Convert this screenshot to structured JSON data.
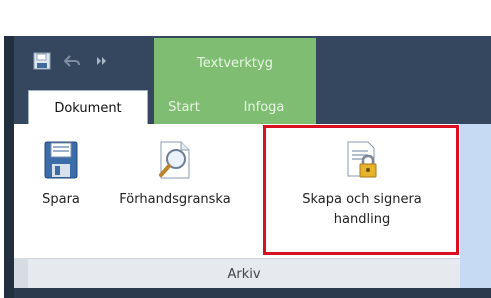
{
  "quick_access": {
    "save_icon": "floppy-save-icon",
    "undo_icon": "undo-arrow-icon",
    "more_icon": "double-chevron-icon"
  },
  "context_group": {
    "title": "Textverktyg"
  },
  "tabs": [
    {
      "label": "Dokument",
      "active": true
    },
    {
      "label": "Start",
      "active": false
    },
    {
      "label": "Infoga",
      "active": false
    }
  ],
  "ribbon": {
    "group_label": "Arkiv",
    "buttons": [
      {
        "label": "Spara",
        "icon": "floppy-save-icon"
      },
      {
        "label": "Förhandsgranska",
        "icon": "magnifier-document-icon"
      },
      {
        "label": "Skapa och signera handling",
        "icon": "document-lock-icon"
      }
    ]
  },
  "colors": {
    "context_tab_green": "#7fbe72",
    "highlight_red": "#d9101f",
    "ribbon_dark": "#34475e"
  }
}
